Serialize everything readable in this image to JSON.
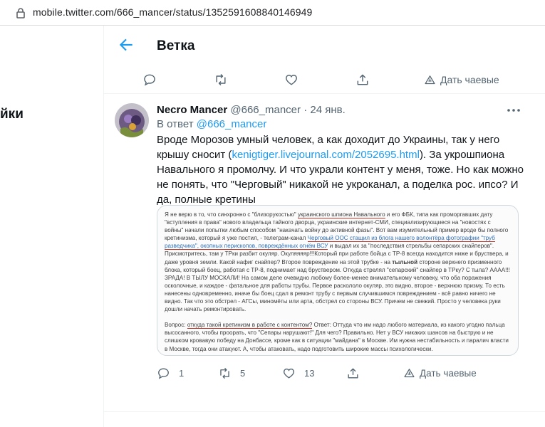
{
  "browser": {
    "url": "mobile.twitter.com/666_mancer/status/1352591608840146949"
  },
  "sidebar_fragment": "йки",
  "header": {
    "title": "Ветка"
  },
  "prev_actions": {
    "tips_label": "Дать чаевые"
  },
  "tweet": {
    "author_name": "Necro Mancer",
    "handle": "@666_mancer",
    "separator": "·",
    "date": "24 янв.",
    "reply_prefix": "В ответ",
    "reply_mention": "@666_mancer",
    "text_before_link": "Вроде Морозов умный человек, а как доходит до Украины, так у него крышу сносит (",
    "link": "kenigtiger.livejournal.com/2052695.html",
    "text_after_link": "). За укрошпиона Навального я промолчу. И что украли контент у меня, тоже. Но как можно не понять, что \"Черговый\" никакой не укроканал, а поделка рос. ипсо? И да, полные кретины",
    "image_text": {
      "p1_a": "Я не верю в то, что синхронно с \"близорукостью\" ",
      "p1_u1": "украинского шпиона Навального",
      "p1_b": " и его ФБК, типа как проморгавших дату \"вступления в права\" нового владельца тайного дворца, украинские интернет-СМИ, специализирующиеся на \"новостях с войны\" начали попытки любым способом \"накачать войну до активной фазы\". Вот вам изумительный пример вроде бы полного кретинизма, который я уже постил, - телеграм-канал ",
      "p1_u2": "Черговый ООС стащил из блога нашего волонтёра фотографии \"труб разведчика\", окопных перископов, повреждённых огнём ВСУ",
      "p1_c": " и выдал их за \"последствия стрельбы сепарских снайперов\". Присмотритесь, там у ТРки разбит окуляр. Окуляяяяр!!!Который при работе бойца с ТР-8 всегда находится ниже и бруствера, и даже уровня земли. Какой нафиг снайпер? Второе повреждение на этой трубке - на ",
      "p1_bold": "тыльной",
      "p1_d": " стороне верхнего призменного блока, который боец, работая с ТР-8, поднимает над бруствером. Откуда стрелял \"сепарский\" снайпер в ТРку? С тыла? АААА!!! ЗРАДА! В ТЫЛУ МОСКАЛИ! На самом деле очевидно любому более-менее внимательному человеку, что оба поражения осколочные, и каждое - фатальное для работы трубы. Первое раскололо окуляр, это видно, второе - верхнюю призму. То есть нанесены одновременно, иначе бы боец сдал в ремонт трубу с первым случившимся повреждением - всё равно ничего не видно. Так что это обстрел - АГСы, миномёты или арта, обстрел со стороны ВСУ. Причем не свежий. Просто у человека руки дошли начать ремонтировать.",
      "p2_a": "Вопрос: ",
      "p2_u": "откуда такой кретинизм в работе с контентом?",
      "p2_b": " Ответ: Оттуда что им надо любого материала, из какого угодно пальца высосанного, чтобы проорать, что \"Сепары нарушают!\" Для чего? Правильно. Нет у ВСУ никаких шансов на быструю и не слишком кровавую победу на Донбассе, кроме как в ситуации \"майдана\" в Москве. Им нужна нестабильность и паралич власти в Москве, тогда они атакуют. А, чтобы атаковать, надо подготовить широкие массы психологически."
    },
    "stats": {
      "replies": "1",
      "retweets": "5",
      "likes": "13",
      "tips_label": "Дать чаевые"
    }
  },
  "colors": {
    "accent": "#1d9bf0",
    "muted": "#536471",
    "text": "#0f1419",
    "border": "#eff3f4"
  }
}
